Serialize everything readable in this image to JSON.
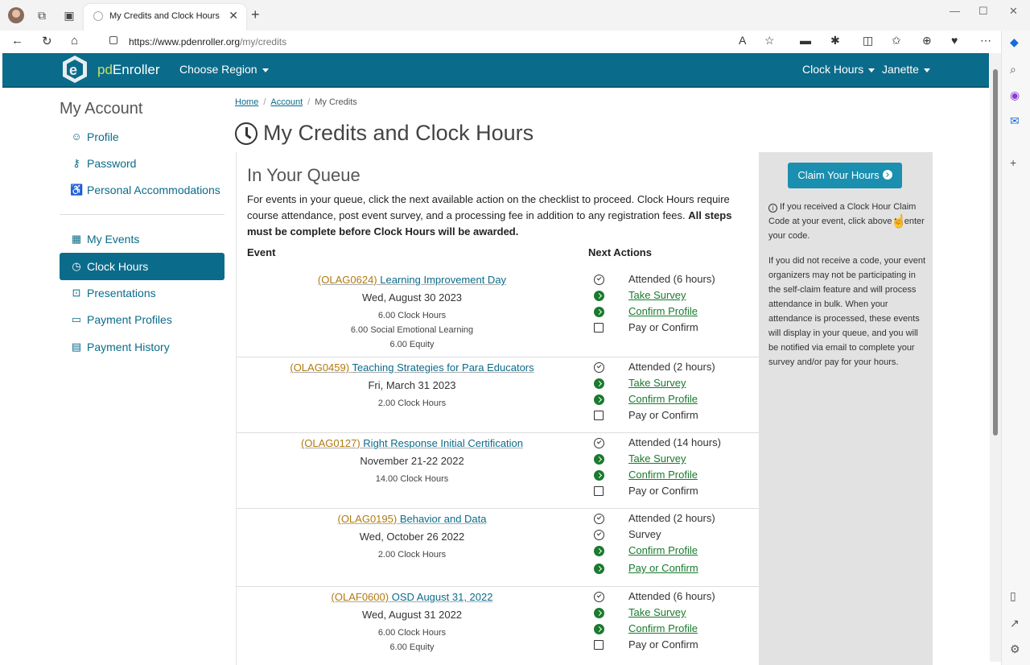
{
  "browser": {
    "tab_title": "My Credits and Clock Hours",
    "url_host": "https://www.pdenroller.org",
    "url_path": "/my/credits"
  },
  "nav": {
    "brand_prefix": "pd",
    "brand_suffix": "Enroller",
    "choose_region": "Choose Region",
    "clock_hours": "Clock Hours",
    "user": "Janette"
  },
  "sidebar": {
    "title": "My Account",
    "items": [
      {
        "label": "Profile",
        "icon": "user-circle-icon"
      },
      {
        "label": "Password",
        "icon": "key-icon"
      },
      {
        "label": "Personal Accommodations",
        "icon": "accessibility-icon"
      },
      {
        "label": "My Events",
        "icon": "calendar-icon"
      },
      {
        "label": "Clock Hours",
        "icon": "clock-icon",
        "active": true
      },
      {
        "label": "Presentations",
        "icon": "presentation-icon"
      },
      {
        "label": "Payment Profiles",
        "icon": "credit-card-icon"
      },
      {
        "label": "Payment History",
        "icon": "receipt-icon"
      }
    ]
  },
  "breadcrumb": {
    "home": "Home",
    "account": "Account",
    "current": "My Credits"
  },
  "page_title": "My Credits and Clock Hours",
  "queue": {
    "title": "In Your Queue",
    "desc_normal": "For events in your queue, click the next available action on the checklist to proceed. Clock Hours require course attendance, post event survey, and a processing fee in addition to any registration fees. ",
    "desc_bold": "All steps must be complete before Clock Hours will be awarded.",
    "col_event": "Event",
    "col_actions": "Next Actions",
    "events": [
      {
        "code": "(OLAG0624)",
        "name": "Learning Improvement Day",
        "date": "Wed, August 30 2023",
        "hours": [
          "6.00 Clock Hours",
          "6.00 Social Emotional Learning",
          "6.00 Equity"
        ],
        "actions": [
          {
            "icon": "check",
            "text": "Attended (6 hours)"
          },
          {
            "icon": "go",
            "text": "Take Survey"
          },
          {
            "icon": "go",
            "text": "Confirm Profile"
          },
          {
            "icon": "box",
            "text": "Pay or Confirm"
          }
        ]
      },
      {
        "code": "(OLAG0459)",
        "name": "Teaching Strategies for Para Educators",
        "date": "Fri, March 31 2023",
        "hours": [
          "2.00 Clock Hours"
        ],
        "actions": [
          {
            "icon": "check",
            "text": "Attended (2 hours)"
          },
          {
            "icon": "go",
            "text": "Take Survey"
          },
          {
            "icon": "go",
            "text": "Confirm Profile"
          },
          {
            "icon": "box",
            "text": "Pay or Confirm"
          }
        ]
      },
      {
        "code": "(OLAG0127)",
        "name": "Right Response Initial Certification",
        "date": "November 21-22 2022",
        "hours": [
          "14.00 Clock Hours"
        ],
        "actions": [
          {
            "icon": "check",
            "text": "Attended (14 hours)"
          },
          {
            "icon": "go",
            "text": "Take Survey"
          },
          {
            "icon": "go",
            "text": "Confirm Profile"
          },
          {
            "icon": "box",
            "text": "Pay or Confirm"
          }
        ]
      },
      {
        "code": "(OLAG0195)",
        "name": "Behavior and Data",
        "date": "Wed, October 26 2022",
        "hours": [
          "2.00 Clock Hours"
        ],
        "actions": [
          {
            "icon": "check",
            "text": "Attended (2 hours)"
          },
          {
            "icon": "check",
            "text": "Survey"
          },
          {
            "icon": "go",
            "text": "Confirm Profile"
          },
          {
            "icon": "go",
            "text": "Pay or Confirm"
          }
        ]
      },
      {
        "code": "(OLAF0600)",
        "name": "OSD August 31, 2022",
        "date": "Wed, August 31 2022",
        "hours": [
          "6.00 Clock Hours",
          "6.00 Equity"
        ],
        "actions": [
          {
            "icon": "check",
            "text": "Attended (6 hours)"
          },
          {
            "icon": "go",
            "text": "Take Survey"
          },
          {
            "icon": "go",
            "text": "Confirm Profile"
          },
          {
            "icon": "box",
            "text": "Pay or Confirm"
          }
        ]
      }
    ]
  },
  "claim": {
    "button": "Claim Your Hours",
    "info1": "If you received a Clock Hour Claim Code at your event, click above to enter your code.",
    "info2": "If you did not receive a code, your event organizers may not be participating in the self-claim feature and will process attendance in bulk. When your attendance is processed, these events will display in your queue, and you will be notified via email to complete your survey and/or pay for your hours."
  }
}
